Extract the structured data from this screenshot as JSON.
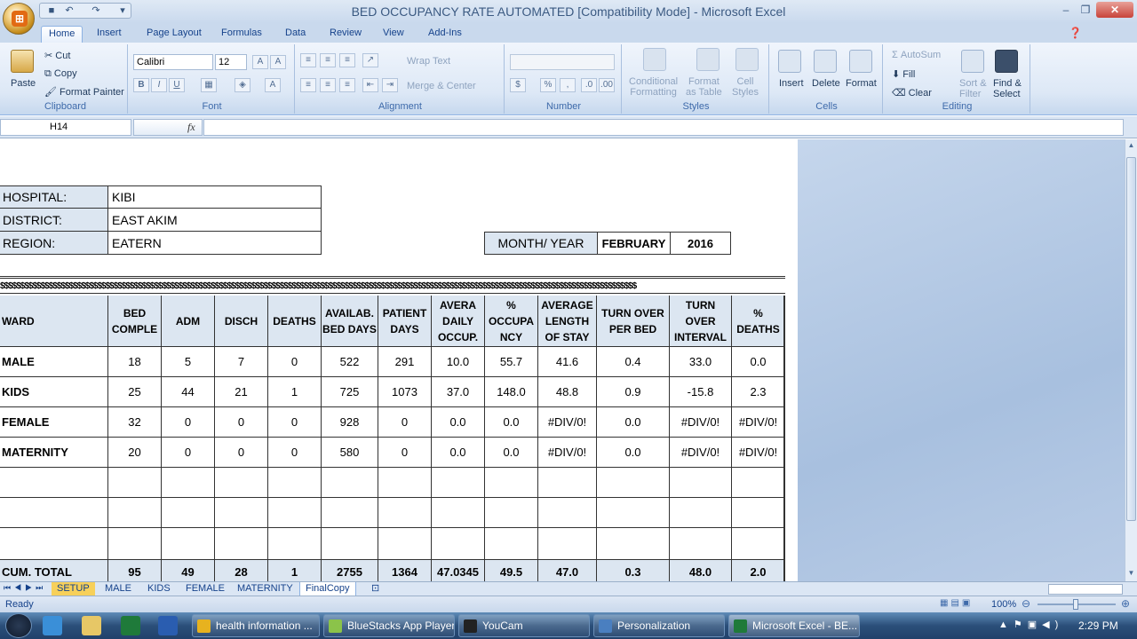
{
  "window": {
    "title": "BED OCCUPANCY RATE AUTOMATED  [Compatibility Mode] - Microsoft Excel"
  },
  "ribbon_tabs": [
    "Home",
    "Insert",
    "Page Layout",
    "Formulas",
    "Data",
    "Review",
    "View",
    "Add-Ins"
  ],
  "ribbon": {
    "clipboard": {
      "paste": "Paste",
      "cut": "Cut",
      "copy": "Copy",
      "format_painter": "Format Painter",
      "label": "Clipboard"
    },
    "font": {
      "name": "Calibri",
      "size": "12",
      "label": "Font"
    },
    "alignment": {
      "wrap": "Wrap Text",
      "merge": "Merge & Center",
      "label": "Alignment"
    },
    "number": {
      "label": "Number",
      "percent": "%"
    },
    "styles": {
      "conditional": "Conditional\nFormatting",
      "format_table": "Format\nas Table",
      "cell_styles": "Cell\nStyles",
      "label": "Styles"
    },
    "cells": {
      "insert": "Insert",
      "delete": "Delete",
      "format": "Format",
      "label": "Cells"
    },
    "editing": {
      "autosum": "AutoSum",
      "fill": "Fill",
      "clear": "Clear",
      "sort": "Sort &\nFilter",
      "find": "Find &\nSelect",
      "label": "Editing"
    }
  },
  "formula_bar": {
    "name_box": "H14",
    "fx": "fx",
    "value": ""
  },
  "info": {
    "hospital_label": "HOSPITAL:",
    "hospital": "KIBI",
    "district_label": "DISTRICT:",
    "district": "EAST AKIM",
    "region_label": "REGION:",
    "region": "EATERN",
    "month_label": "MONTH/ YEAR",
    "month": "FEBRUARY",
    "year": "2016"
  },
  "dollar_row": "$$$$$$$$$$$$$$$$$$$$$$$$$$$$$$$$$$$$$$$$$$$$$$$$$$$$$$$$$$$$$$$$$$$$$$$$$$$$$$$$$$$$$$$$$$$$$$$$$$$$$$$$$$$$$$$$$$$$$$$$$$$$$$$$$$$$$$$$$$$$$$$$$$$$$$$$$$$$$",
  "table": {
    "headers": [
      "WARD",
      "BED COMPLE",
      "ADM",
      "DISCH",
      "DEATHS",
      "AVAILAB. BED DAYS",
      "PATIENT DAYS",
      "AVERA DAILY OCCUP.",
      "% OCCUPA NCY",
      "AVERAGE LENGTH OF STAY",
      "TURN OVER PER BED",
      "TURN OVER INTERVAL",
      "% DEATHS"
    ],
    "rows": [
      [
        "MALE",
        "18",
        "5",
        "7",
        "0",
        "522",
        "291",
        "10.0",
        "55.7",
        "41.6",
        "0.4",
        "33.0",
        "0.0"
      ],
      [
        "KIDS",
        "25",
        "44",
        "21",
        "1",
        "725",
        "1073",
        "37.0",
        "148.0",
        "48.8",
        "0.9",
        "-15.8",
        "2.3"
      ],
      [
        "FEMALE",
        "32",
        "0",
        "0",
        "0",
        "928",
        "0",
        "0.0",
        "0.0",
        "#DIV/0!",
        "0.0",
        "#DIV/0!",
        "#DIV/0!"
      ],
      [
        "MATERNITY",
        "20",
        "0",
        "0",
        "0",
        "580",
        "0",
        "0.0",
        "0.0",
        "#DIV/0!",
        "0.0",
        "#DIV/0!",
        "#DIV/0!"
      ]
    ],
    "total": [
      "CUM. TOTAL",
      "95",
      "49",
      "28",
      "1",
      "2755",
      "1364",
      "47.0345",
      "49.5",
      "47.0",
      "0.3",
      "48.0",
      "2.0"
    ]
  },
  "sheet_tabs": [
    "SETUP",
    "MALE",
    "KIDS",
    "FEMALE",
    "MATERNITY",
    "FinalCopy"
  ],
  "active_sheet": "FinalCopy",
  "status": {
    "ready": "Ready",
    "zoom": "100%"
  },
  "taskbar": {
    "items": [
      "health information ...",
      "BlueStacks App Player",
      "YouCam",
      "Personalization",
      "Microsoft Excel - BE..."
    ],
    "time": "2:29 PM"
  },
  "colors": {
    "header_fill": "#dce6f1",
    "ribbon": "#dde8f6",
    "taskbar": "#2b4f7a"
  }
}
